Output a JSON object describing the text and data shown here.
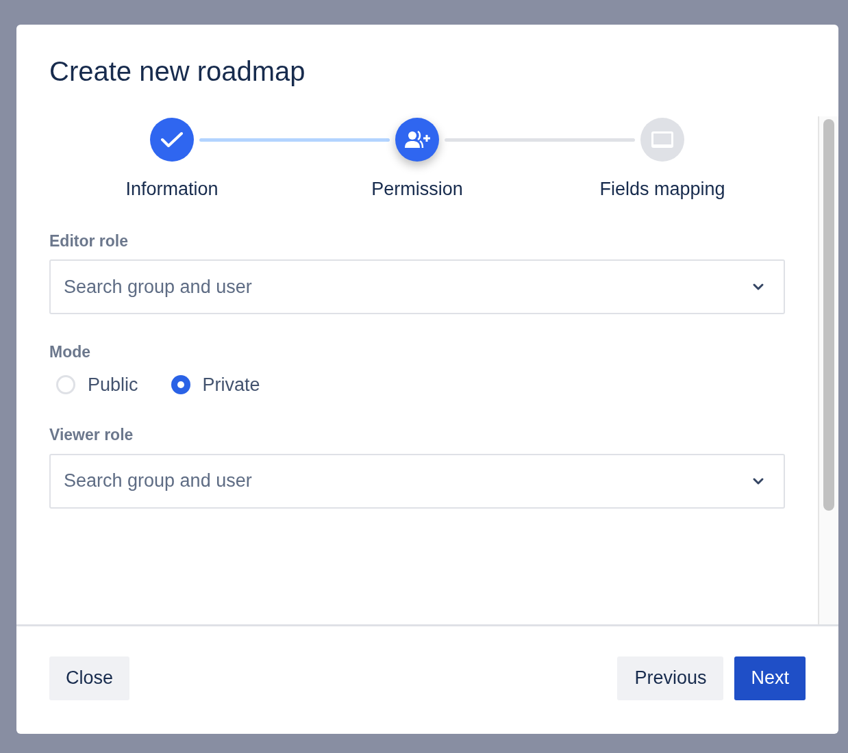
{
  "dialog": {
    "title": "Create new roadmap"
  },
  "steps": [
    {
      "label": "Information",
      "completed": true,
      "selected": false
    },
    {
      "label": "Permission",
      "completed": false,
      "selected": true
    },
    {
      "label": "Fields mapping",
      "completed": false,
      "selected": false
    }
  ],
  "editor_role": {
    "label": "Editor role",
    "placeholder": "Search group and user"
  },
  "mode": {
    "label": "Mode",
    "options": [
      {
        "label": "Public",
        "selected": false
      },
      {
        "label": "Private",
        "selected": true
      }
    ]
  },
  "viewer_role": {
    "label": "Viewer role",
    "placeholder": "Search group and user"
  },
  "footer": {
    "close": "Close",
    "previous": "Previous",
    "next": "Next"
  }
}
